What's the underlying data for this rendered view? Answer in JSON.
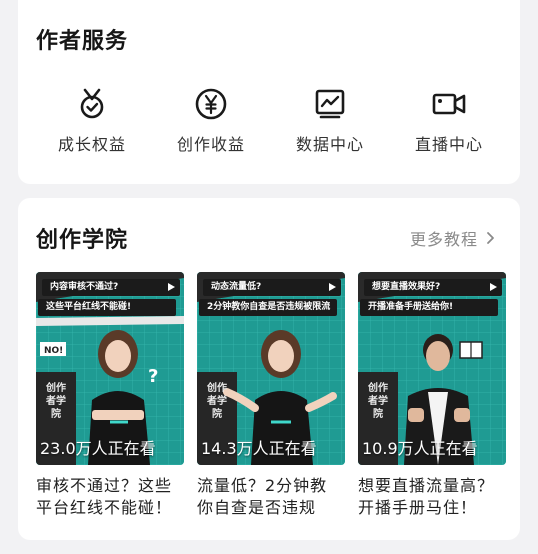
{
  "author_services": {
    "title": "作者服务",
    "items": [
      {
        "label": "成长权益",
        "icon": "medal-icon"
      },
      {
        "label": "创作收益",
        "icon": "yen-coin-icon"
      },
      {
        "label": "数据中心",
        "icon": "chart-monitor-icon"
      },
      {
        "label": "直播中心",
        "icon": "video-camera-icon"
      }
    ]
  },
  "academy": {
    "title": "创作学院",
    "more_label": "更多教程",
    "videos": [
      {
        "banner1": "内容审核不通过?",
        "banner2": "这些平台红线不能碰!",
        "vertical": "创作者学院",
        "viewers": "23.0万人正在看",
        "title_line1": "审核不通过？这些",
        "title_line2": "平台红线不能碰！"
      },
      {
        "banner1": "动态流量低?",
        "banner2": "2分钟教你自查是否违规被限流",
        "vertical": "创作者学院",
        "viewers": "14.3万人正在看",
        "title_line1": "流量低？2分钟教",
        "title_line2": "你自查是否违规"
      },
      {
        "banner1": "想要直播效果好?",
        "banner2": "开播准备手册送给你!",
        "vertical": "创作者学院",
        "viewers": "10.9万人正在看",
        "title_line1": "想要直播流量高？",
        "title_line2": "开播手册马住！"
      }
    ]
  },
  "colors": {
    "accent_teal": "#1f9b93",
    "background": "#f2f2f4",
    "card": "#ffffff"
  }
}
